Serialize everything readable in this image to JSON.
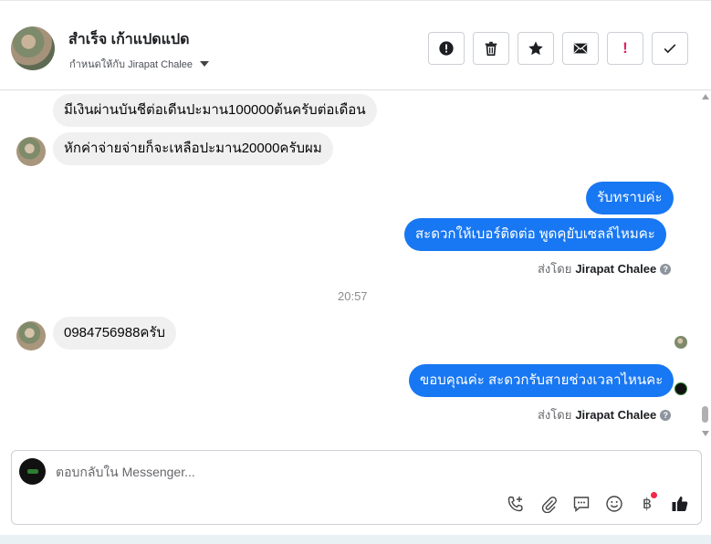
{
  "header": {
    "contact_name": "สำเร็จ เก้าแปดแปด",
    "assigned_to": "กำหนดให้กับ Jirapat Chalee",
    "actions": [
      {
        "name": "mark-spam-button",
        "icon": "alert-circle-icon"
      },
      {
        "name": "delete-button",
        "icon": "trash-icon"
      },
      {
        "name": "star-button",
        "icon": "star-icon"
      },
      {
        "name": "mark-unread-button",
        "icon": "envelope-icon"
      },
      {
        "name": "follow-up-button",
        "icon": "exclamation-icon",
        "label": "!"
      },
      {
        "name": "mark-done-button",
        "icon": "check-icon"
      }
    ]
  },
  "messages": {
    "in_1": "มีเงินผ่านบันชีต่อเดีนปะมาน100000ต้นครับต่อเดือน",
    "in_2": "หักค่าจ่ายจ่ายก็จะเหลือปะมาน20000ครับผม",
    "out_1": "รับทราบค่ะ",
    "out_2": "สะดวกให้เบอร์ติดต่อ พูดคุยับเซลล์ไหมคะ",
    "sent_by_prefix_1": "ส่งโดย",
    "sent_by_name_1": "Jirapat Chalee",
    "time_separator": "20:57",
    "in_3": "0984756988ครับ",
    "out_3": "ขอบคุณค่ะ สะดวกรับสายช่วงเวลาไหนคะ",
    "sent_by_prefix_2": "ส่งโดย",
    "sent_by_name_2": "Jirapat Chalee",
    "help_glyph": "?"
  },
  "composer": {
    "placeholder": "ตอบกลับใน Messenger...",
    "value": "",
    "tools": [
      "phone-add-icon",
      "paperclip-icon",
      "chat-bubble-icon",
      "smiley-icon",
      "baht-icon",
      "thumbs-up-icon"
    ],
    "baht_glyph": "฿",
    "excl_glyph": "!"
  },
  "colors": {
    "outgoing_bubble": "#1877f2",
    "incoming_bubble": "#f0f0f0",
    "badge_red": "#f02849"
  }
}
